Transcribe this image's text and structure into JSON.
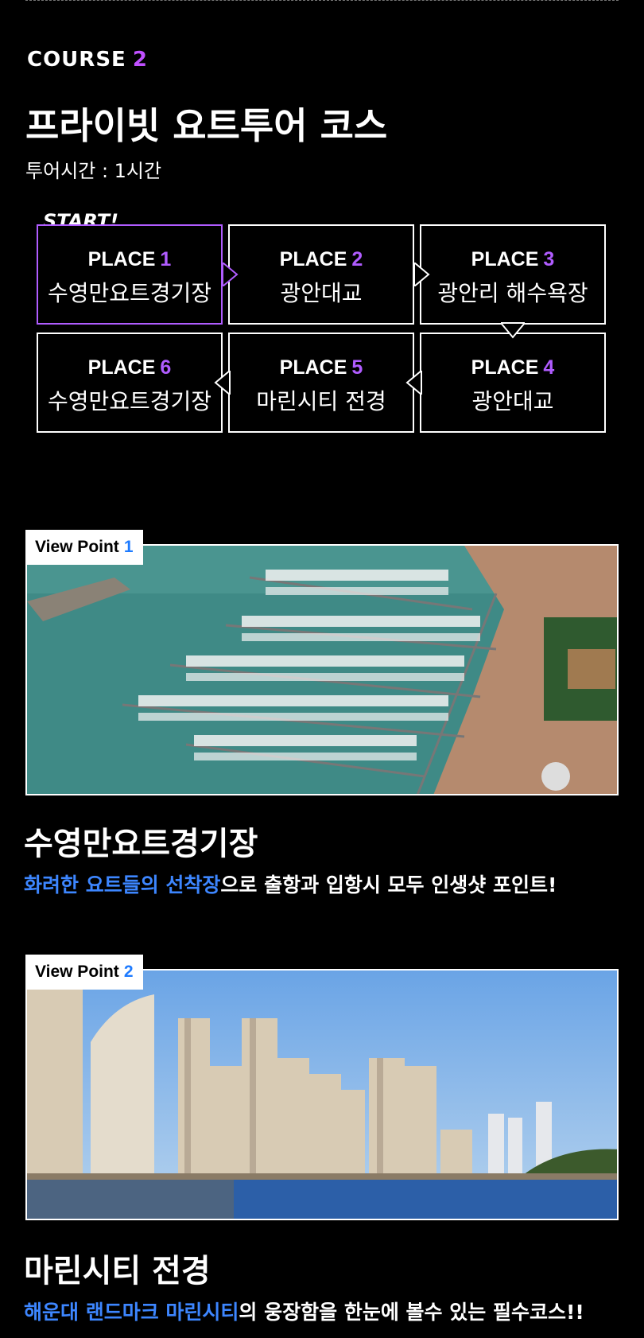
{
  "course": {
    "label": "COURSE",
    "number": "2",
    "title": "프라이빗 요트투어 코스",
    "tour_time": "투어시간 : 1시간",
    "start_label": "START!"
  },
  "places": [
    {
      "label": "PLACE",
      "num": "1",
      "name": "수영만요트경기장"
    },
    {
      "label": "PLACE",
      "num": "2",
      "name": "광안대교"
    },
    {
      "label": "PLACE",
      "num": "3",
      "name": "광안리 해수욕장"
    },
    {
      "label": "PLACE",
      "num": "6",
      "name": "수영만요트경기장"
    },
    {
      "label": "PLACE",
      "num": "5",
      "name": "마린시티 전경"
    },
    {
      "label": "PLACE",
      "num": "4",
      "name": "광안대교"
    }
  ],
  "viewpoints": [
    {
      "tag": "View Point",
      "num": "1",
      "title": "수영만요트경기장",
      "desc_highlight": "화려한 요트들의 선착장",
      "desc_rest": "으로 출항과 입항시 모두 인생샷 포인트!"
    },
    {
      "tag": "View Point",
      "num": "2",
      "title": "마린시티 전경",
      "desc_highlight": "해운대 랜드마크 마린시티",
      "desc_rest": "의 웅장함을 한눈에 볼수 있는 필수코스!!"
    }
  ],
  "colors": {
    "accent_purple": "#b05cff",
    "accent_blue": "#3d86ff",
    "background": "#000000"
  }
}
